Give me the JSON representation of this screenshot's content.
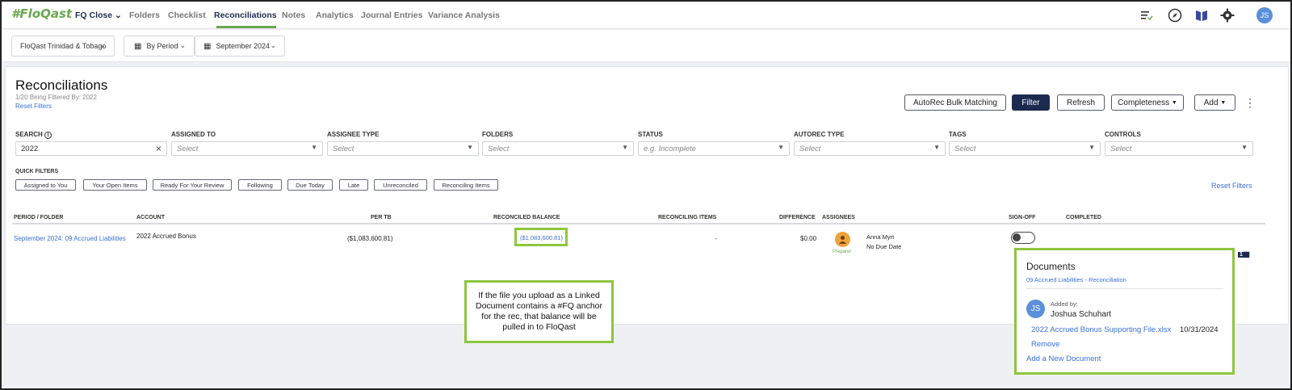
{
  "nav": {
    "logo": "#FloQast",
    "workspace": "FQ Close",
    "items": [
      {
        "label": "Folders"
      },
      {
        "label": "Checklist"
      },
      {
        "label": "Reconciliations"
      },
      {
        "label": "Notes"
      },
      {
        "label": "Analytics"
      },
      {
        "label": "Journal Entries"
      },
      {
        "label": "Variance Analysis"
      }
    ],
    "active": "Reconciliations",
    "user_initials": "JS",
    "icons": [
      "tasks-icon",
      "compass-icon",
      "book-icon",
      "gear-icon"
    ]
  },
  "filterbar": {
    "entity": "FloQast Trinidad & Tobago",
    "period_mode": "By Period",
    "period": "September 2024"
  },
  "page": {
    "title": "Reconciliations",
    "subtitle": "1/20 Being Filtered By: 2022",
    "reset_filters": "Reset Filters",
    "buttons": {
      "autorec": "AutoRec Bulk Matching",
      "filter": "Filter",
      "refresh": "Refresh",
      "completeness": "Completeness",
      "add": "Add"
    }
  },
  "filters": {
    "search": {
      "label": "Search",
      "value": "2022"
    },
    "assigned_to": {
      "label": "Assigned To",
      "placeholder": "Select"
    },
    "assignee_type": {
      "label": "Assignee Type",
      "placeholder": "Select"
    },
    "folders": {
      "label": "Folders",
      "placeholder": "Select"
    },
    "status": {
      "label": "Status",
      "placeholder": "e.g. Incomplete"
    },
    "autorec_type": {
      "label": "AutoRec Type",
      "placeholder": "Select"
    },
    "tags": {
      "label": "Tags",
      "placeholder": "Select"
    },
    "controls": {
      "label": "Controls",
      "placeholder": "Select"
    }
  },
  "quick_filters": {
    "label": "Quick Filters",
    "items": [
      "Assigned to You",
      "Your Open Items",
      "Ready For Your Review",
      "Following",
      "Due Today",
      "Late",
      "Unreconciled",
      "Reconciling Items"
    ],
    "reset": "Reset Filters"
  },
  "table": {
    "columns": [
      "Period / Folder",
      "Account",
      "Per TB",
      "Reconciled Balance",
      "Reconciling Items",
      "Difference",
      "Assignees",
      "Sign-Off",
      "Completed"
    ],
    "rows": [
      {
        "period_folder": "September 2024: 09 Accrued Liabilities",
        "account": "2022 Accrued Bonus",
        "per_tb": "($1,083,600.81)",
        "reconciled_balance": "($1,083,600.81)",
        "reconciling_items": "-",
        "difference": "$0.00",
        "assignee_role": "Preparer",
        "assignee_name": "Anna Myrt",
        "due": "No Due Date"
      }
    ]
  },
  "callout": {
    "text": "If the file you upload as a Linked Document contains a #FQ anchor for the rec, that balance will be pulled in to FloQast"
  },
  "documents": {
    "title": "Documents",
    "subtitle": "09 Accrued Liabilities - Reconciliation",
    "added_by_label": "Added by:",
    "added_by_name": "Joshua Schuhart",
    "added_by_initials": "JS",
    "file_name": "2022 Accrued Bonus Supporting File.xlsx",
    "file_date": "10/31/2024",
    "remove": "Remove",
    "add_new": "Add a New Document",
    "badge": "1"
  },
  "colors": {
    "accent_green": "#8dc63f",
    "link_blue": "#3b6fd8",
    "primary_navy": "#1b2a4e"
  }
}
